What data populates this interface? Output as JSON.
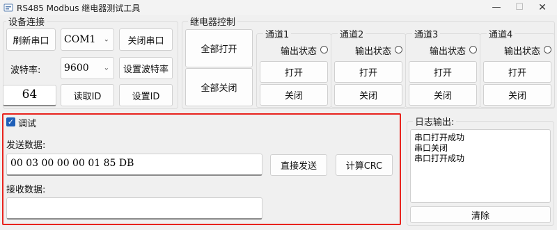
{
  "window": {
    "title": "RS485 Modbus 继电器测试工具",
    "controls": {
      "minimize": "—",
      "maximize": "☐",
      "close": "✕"
    }
  },
  "device": {
    "group_title": "设备连接",
    "refresh_port": "刷新串口",
    "port_value": "COM1",
    "close_port": "关闭串口",
    "baud_label": "波特率:",
    "baud_value": "9600",
    "set_baud": "设置波特率",
    "id_value": "64",
    "read_id": "读取ID",
    "set_id": "设置ID"
  },
  "relay": {
    "group_title": "继电器控制",
    "all_on": "全部打开",
    "all_off": "全部关闭",
    "channels": [
      {
        "title": "通道1",
        "status": "输出状态",
        "on": "打开",
        "off": "关闭"
      },
      {
        "title": "通道2",
        "status": "输出状态",
        "on": "打开",
        "off": "关闭"
      },
      {
        "title": "通道3",
        "status": "输出状态",
        "on": "打开",
        "off": "关闭"
      },
      {
        "title": "通道4",
        "status": "输出状态",
        "on": "打开",
        "off": "关闭"
      }
    ]
  },
  "debug": {
    "checkbox_label": "调试",
    "checked": true,
    "send_label": "发送数据:",
    "send_value": "00 03 00 00 00 01 85 DB",
    "send_button": "直接发送",
    "crc_button": "计算CRC",
    "receive_label": "接收数据:",
    "receive_value": ""
  },
  "log": {
    "group_title": "日志输出:",
    "lines": [
      "串口打开成功",
      "串口关闭",
      "串口打开成功"
    ],
    "clear_button": "清除"
  },
  "colors": {
    "highlight_border": "#e8231d",
    "checkbox": "#1e5fb8"
  }
}
